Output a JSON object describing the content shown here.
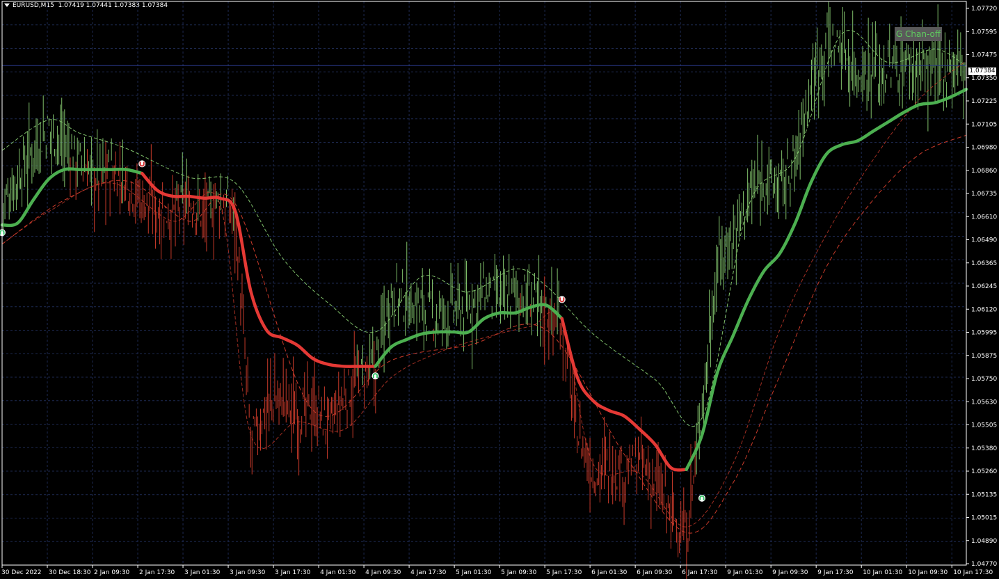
{
  "header": {
    "symbol": "EURUSD,M15",
    "open": "1.07419",
    "high": "1.07441",
    "low": "1.07383",
    "close": "1.07384"
  },
  "indicator_label": "G Chan-off",
  "current_price_label": "1.07384",
  "colors": {
    "background": "#000000",
    "grid": "#1e2a52",
    "bull": "#7fbf6a",
    "bear": "#c83a2a",
    "main_up": "#4caf50",
    "main_down": "#e53935",
    "frame": "#ffffff",
    "price_line": "#2a3a8c"
  },
  "chart_data": {
    "type": "line",
    "yaxis_ticks": [
      "1.07720",
      "1.07595",
      "1.07475",
      "1.07350",
      "1.07225",
      "1.07105",
      "1.06980",
      "1.06860",
      "1.06735",
      "1.06610",
      "1.06490",
      "1.06365",
      "1.06245",
      "1.06120",
      "1.05995",
      "1.05875",
      "1.05750",
      "1.05630",
      "1.05505",
      "1.05380",
      "1.05260",
      "1.05135",
      "1.05015",
      "1.04890",
      "1.04770"
    ],
    "ylim": [
      1.0477,
      1.0772
    ],
    "xaxis_ticks": [
      "30 Dec 2022",
      "30 Dec 18:30",
      "2 Jan 09:30",
      "2 Jan 17:30",
      "3 Jan 01:30",
      "3 Jan 09:30",
      "3 Jan 17:30",
      "4 Jan 01:30",
      "4 Jan 09:30",
      "4 Jan 17:30",
      "5 Jan 01:30",
      "5 Jan 09:30",
      "5 Jan 17:30",
      "6 Jan 01:30",
      "6 Jan 09:30",
      "6 Jan 17:30",
      "9 Jan 01:30",
      "9 Jan 09:30",
      "9 Jan 17:30",
      "10 Jan 01:30",
      "10 Jan 09:30",
      "10 Jan 17:30"
    ],
    "current_price": 1.07384,
    "main_line": [
      {
        "i": 0,
        "y": 1.0655
      },
      {
        "i": 1,
        "y": 1.0656
      },
      {
        "i": 2,
        "y": 1.0668
      },
      {
        "i": 3,
        "y": 1.0679
      },
      {
        "i": 4,
        "y": 1.0684
      },
      {
        "i": 5,
        "y": 1.0684
      },
      {
        "i": 6,
        "y": 1.0684
      },
      {
        "i": 7,
        "y": 1.0684
      },
      {
        "i": 8,
        "y": 1.0684
      },
      {
        "i": 9,
        "y": 1.0682
      },
      {
        "i": 10,
        "y": 1.0673
      },
      {
        "i": 11,
        "y": 1.067
      },
      {
        "i": 12,
        "y": 1.067
      },
      {
        "i": 13,
        "y": 1.0669
      },
      {
        "i": 14,
        "y": 1.0669
      },
      {
        "i": 15,
        "y": 1.0662
      },
      {
        "i": 16,
        "y": 1.062
      },
      {
        "i": 17,
        "y": 1.06
      },
      {
        "i": 18,
        "y": 1.0596
      },
      {
        "i": 19,
        "y": 1.0592
      },
      {
        "i": 20,
        "y": 1.0585
      },
      {
        "i": 21,
        "y": 1.0582
      },
      {
        "i": 22,
        "y": 1.0581
      },
      {
        "i": 23,
        "y": 1.0581
      },
      {
        "i": 24,
        "y": 1.0581
      },
      {
        "i": 25,
        "y": 1.0591
      },
      {
        "i": 26,
        "y": 1.0595
      },
      {
        "i": 27,
        "y": 1.0598
      },
      {
        "i": 28,
        "y": 1.0599
      },
      {
        "i": 29,
        "y": 1.0599
      },
      {
        "i": 30,
        "y": 1.0599
      },
      {
        "i": 31,
        "y": 1.0606
      },
      {
        "i": 32,
        "y": 1.0609
      },
      {
        "i": 33,
        "y": 1.0609
      },
      {
        "i": 34,
        "y": 1.0612
      },
      {
        "i": 35,
        "y": 1.0613
      },
      {
        "i": 36,
        "y": 1.0606
      },
      {
        "i": 37,
        "y": 1.0575
      },
      {
        "i": 38,
        "y": 1.0563
      },
      {
        "i": 39,
        "y": 1.0558
      },
      {
        "i": 40,
        "y": 1.0555
      },
      {
        "i": 41,
        "y": 1.0548
      },
      {
        "i": 42,
        "y": 1.054
      },
      {
        "i": 43,
        "y": 1.0528
      },
      {
        "i": 44,
        "y": 1.0527
      },
      {
        "i": 45,
        "y": 1.0545
      },
      {
        "i": 46,
        "y": 1.0578
      },
      {
        "i": 47,
        "y": 1.0597
      },
      {
        "i": 48,
        "y": 1.0616
      },
      {
        "i": 49,
        "y": 1.0631
      },
      {
        "i": 50,
        "y": 1.064
      },
      {
        "i": 51,
        "y": 1.0656
      },
      {
        "i": 52,
        "y": 1.0677
      },
      {
        "i": 53,
        "y": 1.0692
      },
      {
        "i": 54,
        "y": 1.0697
      },
      {
        "i": 55,
        "y": 1.0699
      },
      {
        "i": 56,
        "y": 1.0704
      },
      {
        "i": 57,
        "y": 1.0709
      },
      {
        "i": 58,
        "y": 1.0714
      },
      {
        "i": 59,
        "y": 1.0718
      },
      {
        "i": 60,
        "y": 1.0719
      },
      {
        "i": 61,
        "y": 1.0722
      },
      {
        "i": 62,
        "y": 1.0726
      }
    ],
    "upper_band": [
      {
        "i": 0,
        "y": 1.0694
      },
      {
        "i": 3,
        "y": 1.071
      },
      {
        "i": 5,
        "y": 1.0703
      },
      {
        "i": 8,
        "y": 1.0695
      },
      {
        "i": 12,
        "y": 1.068
      },
      {
        "i": 15,
        "y": 1.0677
      },
      {
        "i": 18,
        "y": 1.0638
      },
      {
        "i": 21,
        "y": 1.0614
      },
      {
        "i": 24,
        "y": 1.0599
      },
      {
        "i": 27,
        "y": 1.0628
      },
      {
        "i": 30,
        "y": 1.062
      },
      {
        "i": 33,
        "y": 1.0632
      },
      {
        "i": 35,
        "y": 1.0623
      },
      {
        "i": 38,
        "y": 1.0598
      },
      {
        "i": 42,
        "y": 1.0574
      },
      {
        "i": 45,
        "y": 1.0554
      },
      {
        "i": 48,
        "y": 1.0665
      },
      {
        "i": 51,
        "y": 1.069
      },
      {
        "i": 54,
        "y": 1.0755
      },
      {
        "i": 57,
        "y": 1.074
      },
      {
        "i": 60,
        "y": 1.0747
      },
      {
        "i": 62,
        "y": 1.0738
      }
    ],
    "lower_band": [
      {
        "i": 0,
        "y": 1.0645
      },
      {
        "i": 3,
        "y": 1.0662
      },
      {
        "i": 7,
        "y": 1.0677
      },
      {
        "i": 11,
        "y": 1.0657
      },
      {
        "i": 14,
        "y": 1.0666
      },
      {
        "i": 16,
        "y": 1.0545
      },
      {
        "i": 19,
        "y": 1.0552
      },
      {
        "i": 22,
        "y": 1.0548
      },
      {
        "i": 25,
        "y": 1.0575
      },
      {
        "i": 28,
        "y": 1.0588
      },
      {
        "i": 31,
        "y": 1.0596
      },
      {
        "i": 34,
        "y": 1.0602
      },
      {
        "i": 36,
        "y": 1.0605
      },
      {
        "i": 38,
        "y": 1.053
      },
      {
        "i": 41,
        "y": 1.0525
      },
      {
        "i": 44,
        "y": 1.0497
      },
      {
        "i": 47,
        "y": 1.053
      },
      {
        "i": 50,
        "y": 1.06
      },
      {
        "i": 53,
        "y": 1.065
      },
      {
        "i": 56,
        "y": 1.0689
      },
      {
        "i": 59,
        "y": 1.0721
      },
      {
        "i": 62,
        "y": 1.0741
      }
    ],
    "slow_line": [
      {
        "i": 0,
        "y": 1.0645
      },
      {
        "i": 4,
        "y": 1.0668
      },
      {
        "i": 8,
        "y": 1.0678
      },
      {
        "i": 12,
        "y": 1.0657
      },
      {
        "i": 15,
        "y": 1.0666
      },
      {
        "i": 20,
        "y": 1.0558
      },
      {
        "i": 25,
        "y": 1.0584
      },
      {
        "i": 30,
        "y": 1.0592
      },
      {
        "i": 35,
        "y": 1.06
      },
      {
        "i": 40,
        "y": 1.0535
      },
      {
        "i": 44,
        "y": 1.0494
      },
      {
        "i": 47,
        "y": 1.052
      },
      {
        "i": 50,
        "y": 1.0576
      },
      {
        "i": 53,
        "y": 1.0633
      },
      {
        "i": 56,
        "y": 1.0668
      },
      {
        "i": 59,
        "y": 1.0692
      },
      {
        "i": 62,
        "y": 1.0702
      }
    ],
    "price_path": [
      {
        "i": 0,
        "y": 1.0665
      },
      {
        "i": 1,
        "y": 1.068
      },
      {
        "i": 2,
        "y": 1.0695
      },
      {
        "i": 3,
        "y": 1.0705
      },
      {
        "i": 4,
        "y": 1.0697
      },
      {
        "i": 5,
        "y": 1.0688
      },
      {
        "i": 6,
        "y": 1.068
      },
      {
        "i": 7,
        "y": 1.0683
      },
      {
        "i": 8,
        "y": 1.0678
      },
      {
        "i": 9,
        "y": 1.0668
      },
      {
        "i": 10,
        "y": 1.0663
      },
      {
        "i": 11,
        "y": 1.066
      },
      {
        "i": 12,
        "y": 1.0668
      },
      {
        "i": 13,
        "y": 1.066
      },
      {
        "i": 14,
        "y": 1.0668
      },
      {
        "i": 15,
        "y": 1.066
      },
      {
        "i": 16,
        "y": 1.054
      },
      {
        "i": 17,
        "y": 1.056
      },
      {
        "i": 18,
        "y": 1.0565
      },
      {
        "i": 19,
        "y": 1.0555
      },
      {
        "i": 20,
        "y": 1.056
      },
      {
        "i": 21,
        "y": 1.055
      },
      {
        "i": 22,
        "y": 1.0565
      },
      {
        "i": 23,
        "y": 1.0575
      },
      {
        "i": 24,
        "y": 1.058
      },
      {
        "i": 25,
        "y": 1.062
      },
      {
        "i": 26,
        "y": 1.0615
      },
      {
        "i": 27,
        "y": 1.0612
      },
      {
        "i": 28,
        "y": 1.0606
      },
      {
        "i": 29,
        "y": 1.061
      },
      {
        "i": 30,
        "y": 1.0612
      },
      {
        "i": 31,
        "y": 1.062
      },
      {
        "i": 32,
        "y": 1.0615
      },
      {
        "i": 33,
        "y": 1.062
      },
      {
        "i": 34,
        "y": 1.0616
      },
      {
        "i": 35,
        "y": 1.061
      },
      {
        "i": 36,
        "y": 1.0605
      },
      {
        "i": 37,
        "y": 1.0545
      },
      {
        "i": 38,
        "y": 1.0525
      },
      {
        "i": 39,
        "y": 1.053
      },
      {
        "i": 40,
        "y": 1.0525
      },
      {
        "i": 41,
        "y": 1.053
      },
      {
        "i": 42,
        "y": 1.052
      },
      {
        "i": 43,
        "y": 1.0505
      },
      {
        "i": 44,
        "y": 1.049
      },
      {
        "i": 45,
        "y": 1.056
      },
      {
        "i": 46,
        "y": 1.0635
      },
      {
        "i": 47,
        "y": 1.065
      },
      {
        "i": 48,
        "y": 1.067
      },
      {
        "i": 49,
        "y": 1.068
      },
      {
        "i": 50,
        "y": 1.0675
      },
      {
        "i": 51,
        "y": 1.0688
      },
      {
        "i": 52,
        "y": 1.073
      },
      {
        "i": 53,
        "y": 1.0752
      },
      {
        "i": 54,
        "y": 1.0747
      },
      {
        "i": 55,
        "y": 1.0735
      },
      {
        "i": 56,
        "y": 1.0738
      },
      {
        "i": 57,
        "y": 1.0735
      },
      {
        "i": 58,
        "y": 1.074
      },
      {
        "i": 59,
        "y": 1.0738
      },
      {
        "i": 60,
        "y": 1.0735
      },
      {
        "i": 61,
        "y": 1.074
      },
      {
        "i": 62,
        "y": 1.0738
      }
    ],
    "signals": [
      {
        "type": "buy",
        "i": 0,
        "y": 1.0651
      },
      {
        "type": "sell",
        "i": 9,
        "y": 1.0687
      },
      {
        "type": "buy",
        "i": 24,
        "y": 1.0576
      },
      {
        "type": "sell",
        "i": 36,
        "y": 1.0616
      },
      {
        "type": "buy",
        "i": 45,
        "y": 1.0512
      }
    ],
    "grid": true
  }
}
